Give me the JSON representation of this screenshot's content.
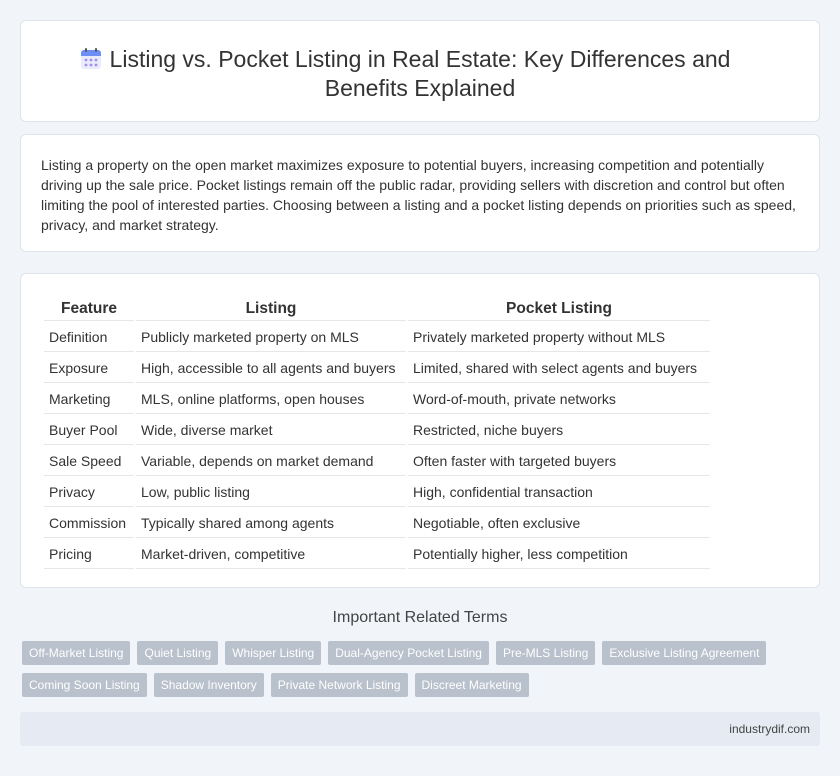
{
  "header": {
    "icon": "calendar-icon",
    "title": "Listing vs. Pocket Listing in Real Estate: Key Differences and Benefits Explained"
  },
  "intro": {
    "text": "Listing a property on the open market maximizes exposure to potential buyers, increasing competition and potentially driving up the sale price. Pocket listings remain off the public radar, providing sellers with discretion and control but often limiting the pool of interested parties. Choosing between a listing and a pocket listing depends on priorities such as speed, privacy, and market strategy."
  },
  "table": {
    "headers": [
      "Feature",
      "Listing",
      "Pocket Listing"
    ],
    "rows": [
      [
        "Definition",
        "Publicly marketed property on MLS",
        "Privately marketed property without MLS"
      ],
      [
        "Exposure",
        "High, accessible to all agents and buyers",
        "Limited, shared with select agents and buyers"
      ],
      [
        "Marketing",
        "MLS, online platforms, open houses",
        "Word-of-mouth, private networks"
      ],
      [
        "Buyer Pool",
        "Wide, diverse market",
        "Restricted, niche buyers"
      ],
      [
        "Sale Speed",
        "Variable, depends on market demand",
        "Often faster with targeted buyers"
      ],
      [
        "Privacy",
        "Low, public listing",
        "High, confidential transaction"
      ],
      [
        "Commission",
        "Typically shared among agents",
        "Negotiable, often exclusive"
      ],
      [
        "Pricing",
        "Market-driven, competitive",
        "Potentially higher, less competition"
      ]
    ]
  },
  "related": {
    "title": "Important Related Terms",
    "tags": [
      "Off-Market Listing",
      "Quiet Listing",
      "Whisper Listing",
      "Dual-Agency Pocket Listing",
      "Pre-MLS Listing",
      "Exclusive Listing Agreement",
      "Coming Soon Listing",
      "Shadow Inventory",
      "Private Network Listing",
      "Discreet Marketing"
    ]
  },
  "footer": {
    "text": "industrydif.com"
  },
  "colors": {
    "background": "#f1f4f9",
    "tag": "#b8c1cc",
    "footer": "#e5eaf3",
    "icon_accent": "#6c8ef5"
  }
}
